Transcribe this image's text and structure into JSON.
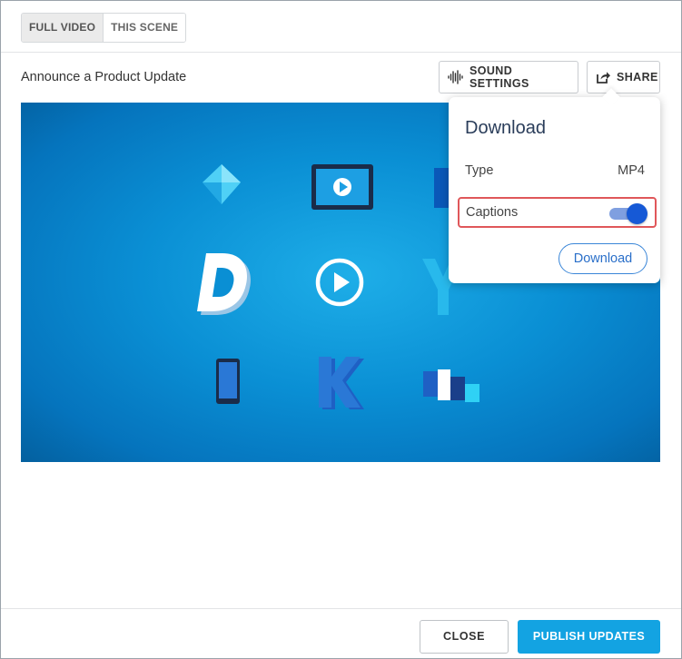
{
  "tabs": [
    {
      "label": "FULL VIDEO",
      "active": true
    },
    {
      "label": "THIS SCENE",
      "active": false
    }
  ],
  "scene": {
    "title": "Announce a Product Update"
  },
  "toolbar": {
    "sound_settings_label": "SOUND SETTINGS",
    "share_label": "SHARE",
    "sound_icon": "waveform-icon",
    "share_icon": "share-icon"
  },
  "video": {
    "play_icon": "play-icon",
    "letters": [
      "D",
      "Y",
      "K"
    ]
  },
  "download_popover": {
    "title": "Download",
    "type_label": "Type",
    "type_value": "MP4",
    "captions_label": "Captions",
    "captions_enabled": true,
    "download_button": "Download"
  },
  "footer": {
    "close_label": "CLOSE",
    "publish_label": "PUBLISH UPDATES"
  },
  "colors": {
    "accent": "#13a3e2",
    "toggle_on": "#1659d6",
    "highlight_border": "#e0575a"
  }
}
